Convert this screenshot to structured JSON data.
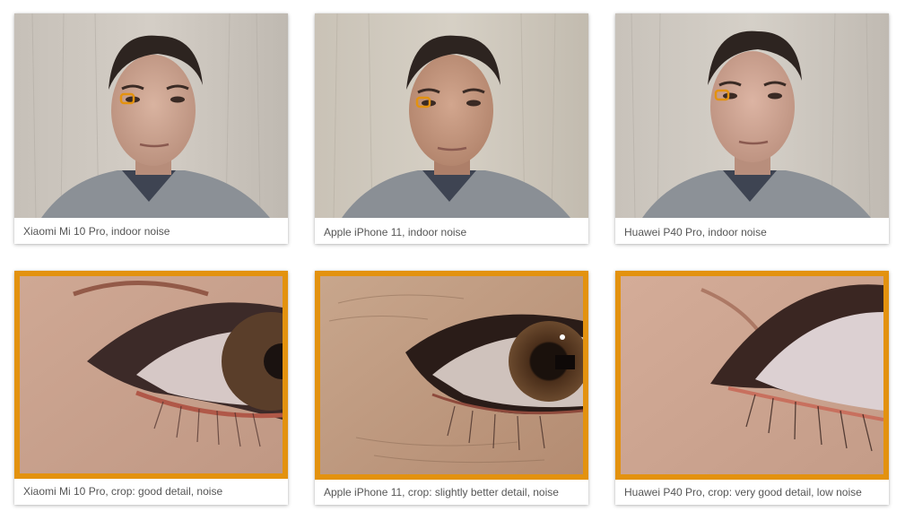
{
  "accent_color": "#e3920f",
  "portraits": [
    {
      "caption": "Xiaomi Mi 10 Pro, indoor noise"
    },
    {
      "caption": "Apple iPhone 11, indoor noise"
    },
    {
      "caption": "Huawei P40 Pro, indoor noise"
    }
  ],
  "crops": [
    {
      "caption": "Xiaomi Mi 10 Pro, crop: good detail, noise"
    },
    {
      "caption": "Apple iPhone 11, crop: slightly better detail, noise"
    },
    {
      "caption": "Huawei P40 Pro, crop: very good detail, low noise"
    }
  ]
}
